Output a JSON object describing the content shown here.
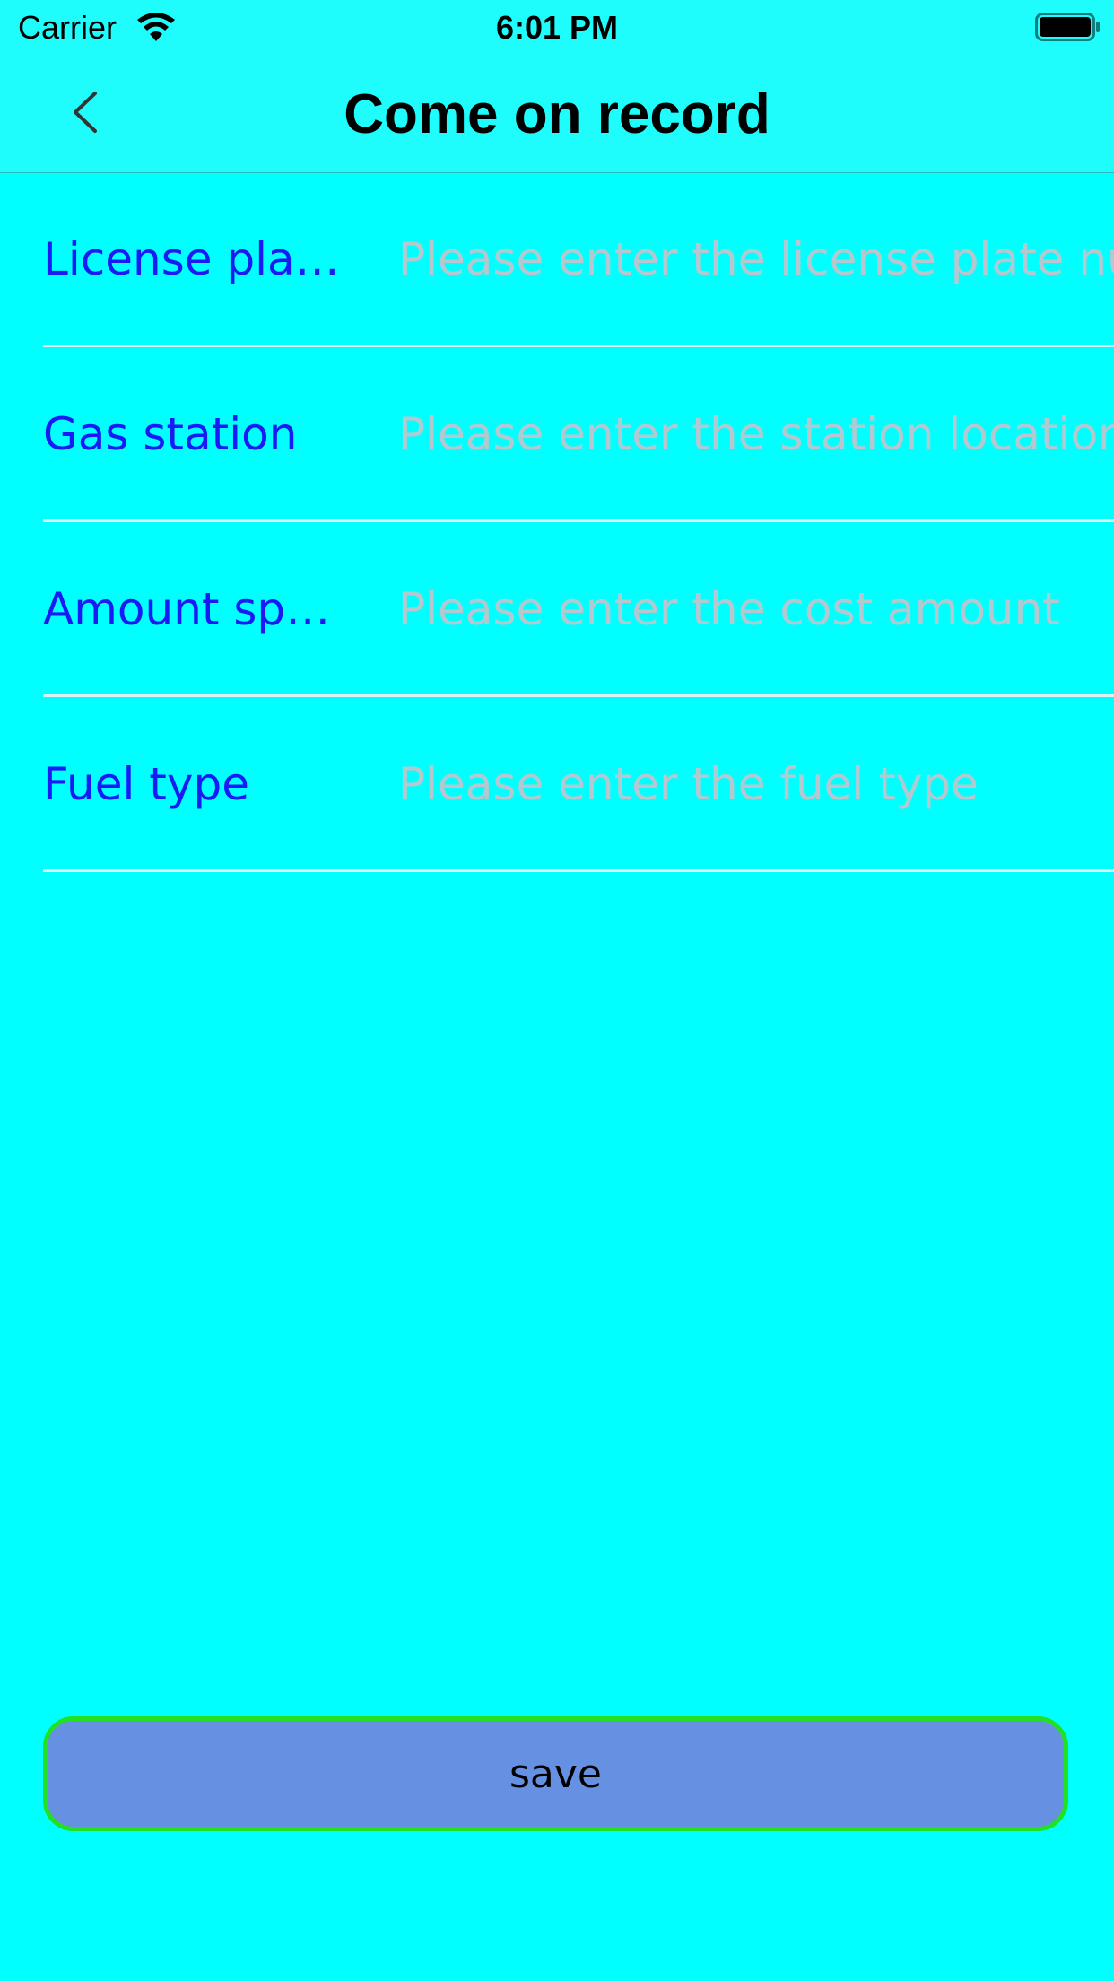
{
  "status_bar": {
    "carrier": "Carrier",
    "time": "6:01 PM",
    "wifi_icon": "wifi-icon",
    "battery_icon": "battery-full-icon"
  },
  "nav": {
    "title": "Come on record",
    "back_icon": "chevron-left-icon"
  },
  "form": {
    "rows": [
      {
        "label": "License plate number",
        "placeholder": "Please enter the license plate number",
        "value": ""
      },
      {
        "label": "Gas station",
        "placeholder": "Please enter the station location",
        "value": ""
      },
      {
        "label": "Amount spent",
        "placeholder": "Please enter the cost amount",
        "value": ""
      },
      {
        "label": "Fuel type",
        "placeholder": "Please enter the fuel type",
        "value": ""
      }
    ]
  },
  "save_button": {
    "label": "save"
  },
  "colors": {
    "background": "#00ffff",
    "label_text": "#1a1af5",
    "placeholder_text": "#b4c8d0",
    "save_fill": "#6691e3",
    "save_border": "#22e022"
  }
}
